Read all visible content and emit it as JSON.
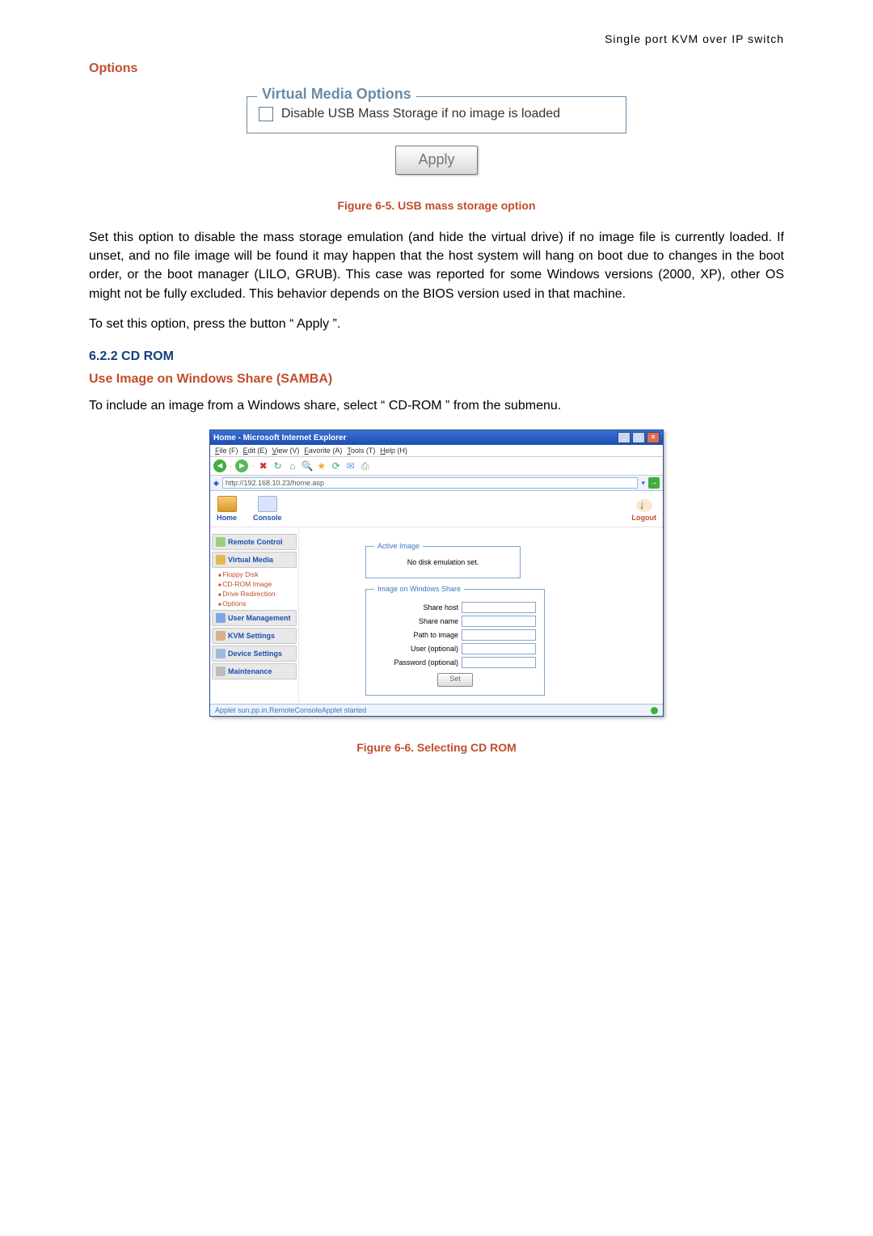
{
  "header_right": "Single port KVM over IP switch",
  "options_heading": "Options",
  "fig1": {
    "legend": "Virtual Media Options",
    "checkbox_label": "Disable USB Mass Storage if no image is loaded",
    "apply": "Apply",
    "caption": "Figure 6-5. USB mass storage option"
  },
  "para1": "Set this option to disable the mass storage emulation (and hide the virtual drive) if no image file is currently loaded. If unset, and no file image will be found it may happen that the host system will hang on boot due to changes in the boot order, or the boot manager (LILO, GRUB). This case was reported for some Windows versions (2000, XP), other OS might not be fully excluded. This behavior depends on the BIOS version used in that machine.",
  "para2": "To set this option, press the button “ Apply ”.",
  "sec622": "6.2.2   CD ROM",
  "sub_heading": "Use Image on Windows Share (SAMBA)",
  "para3": "To include an image from a Windows share, select “ CD-ROM ” from the submenu.",
  "ie": {
    "title": "Home - Microsoft Internet Explorer",
    "menu": [
      "File (F)",
      "Edit (E)",
      "View (V)",
      "Favorite (A)",
      "Tools (T)",
      "Help (H)"
    ],
    "address": "http://192.168.10.23/home.asp",
    "nav": {
      "home": "Home",
      "console": "Console",
      "logout": "Logout"
    },
    "sidebar": {
      "remote_control": "Remote Control",
      "virtual_media": "Virtual Media",
      "subs": [
        "Floppy Disk",
        "CD-ROM Image",
        "Drive Redirection",
        "Options"
      ],
      "user_mgmt": "User Management",
      "kvm": "KVM Settings",
      "device": "Device Settings",
      "maint": "Maintenance"
    },
    "active_image": {
      "legend": "Active Image",
      "msg": "No disk emulation set."
    },
    "winshare": {
      "legend": "Image on Windows Share",
      "share_host": "Share host",
      "share_name": "Share name",
      "path": "Path to image",
      "user": "User (optional)",
      "pass": "Password (optional)",
      "set": "Set"
    },
    "status": "Applet sun.pp.in.RemoteConsoleApplet started"
  },
  "fig2_caption": "Figure 6-6. Selecting CD ROM"
}
